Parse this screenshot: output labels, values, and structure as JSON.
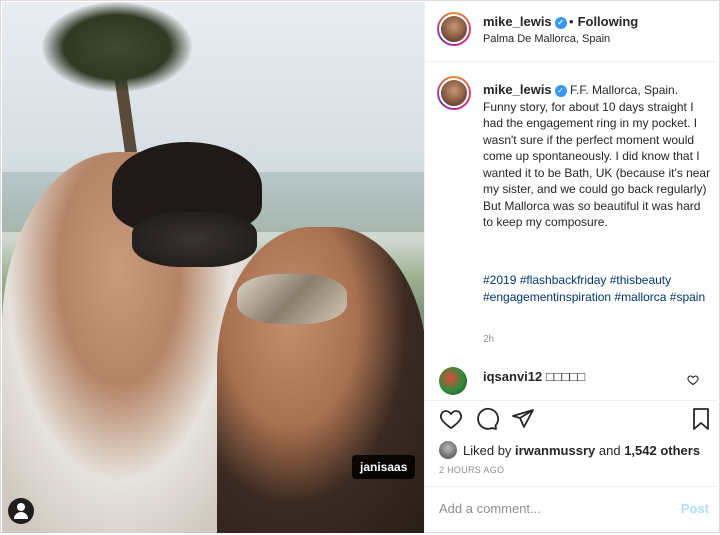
{
  "post": {
    "photo_tag": "janisaas"
  },
  "header": {
    "username": "mike_lewis",
    "following_label": "Following",
    "location": "Palma De Mallorca, Spain"
  },
  "caption": {
    "username": "mike_lewis",
    "text": "F.F. Mallorca, Spain. Funny story, for about 10 days straight I had the engagement ring in my pocket. I wasn't sure if the perfect moment would come up spontaneously. I did know that I wanted it to be Bath, UK (because it's near my sister, and we could go back regularly) But Mallorca was so beautiful it was hard to keep my composure.",
    "hashtags": "#2019 #flashbackfriday #thisbeauty #engagementinspiration #mallorca #spain",
    "age": "2h"
  },
  "comment": {
    "username": "iqsanvi12",
    "text": "□□□□□"
  },
  "likes": {
    "prefix": "Liked by",
    "user": "irwanmussry",
    "joiner": "and",
    "others": "1,542 others"
  },
  "timestamp": "2 HOURS AGO",
  "add_comment": {
    "placeholder": "Add a comment...",
    "post_label": "Post"
  },
  "colors": {
    "link": "#00376b",
    "verified": "#3897f0",
    "post_disabled": "#b2dffc"
  }
}
